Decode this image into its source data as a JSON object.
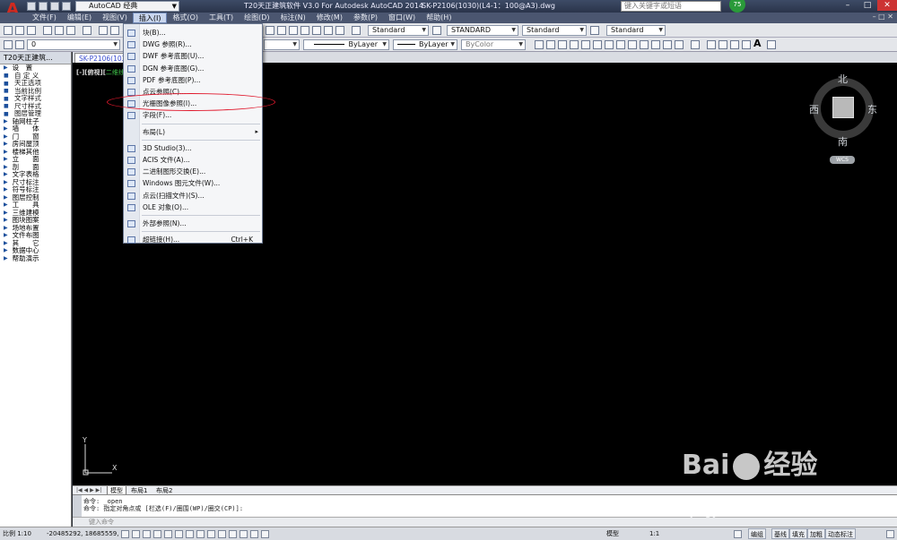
{
  "app": {
    "title": "T20天正建筑软件 V3.0 For Autodesk AutoCAD 2014",
    "file": "SK-P2106(1030)(L4-1：100@A3).dwg",
    "workspace": "AutoCAD 经典",
    "search_placeholder": "键入关键字或短语",
    "badge": "75"
  },
  "menubar": {
    "items": [
      "文件(F)",
      "编辑(E)",
      "视图(V)",
      "插入(I)",
      "格式(O)",
      "工具(T)",
      "绘图(D)",
      "标注(N)",
      "修改(M)",
      "参数(P)",
      "窗口(W)",
      "帮助(H)"
    ],
    "active_index": 3
  },
  "toolbar1": {
    "text_style": "Standard",
    "dim_style": "STANDARD",
    "table_style": "Standard",
    "mleader_style": "Standard"
  },
  "toolbar2": {
    "layer": "0",
    "linetype": "ByLayer",
    "lineweight": "ByLayer",
    "color": "ByColor"
  },
  "left_panel": {
    "header": "T20天正建筑...",
    "items": [
      {
        "label": "设　置",
        "kind": "section"
      },
      {
        "label": "自 定 义",
        "kind": "item"
      },
      {
        "label": "天正选项",
        "kind": "item"
      },
      {
        "label": "当前比例",
        "kind": "item"
      },
      {
        "label": "文字样式",
        "kind": "item"
      },
      {
        "label": "尺寸样式",
        "kind": "item"
      },
      {
        "label": "图层管理",
        "kind": "item"
      },
      {
        "label": "轴网柱子",
        "kind": "section"
      },
      {
        "label": "墙　　体",
        "kind": "section"
      },
      {
        "label": "门　　窗",
        "kind": "section"
      },
      {
        "label": "房间屋顶",
        "kind": "section"
      },
      {
        "label": "楼梯其他",
        "kind": "section"
      },
      {
        "label": "立　　面",
        "kind": "section"
      },
      {
        "label": "剖　　面",
        "kind": "section"
      },
      {
        "label": "文字表格",
        "kind": "section"
      },
      {
        "label": "尺寸标注",
        "kind": "section"
      },
      {
        "label": "符号标注",
        "kind": "section"
      },
      {
        "label": "图层控制",
        "kind": "section"
      },
      {
        "label": "工　　具",
        "kind": "section"
      },
      {
        "label": "三维建模",
        "kind": "section"
      },
      {
        "label": "图块图案",
        "kind": "section"
      },
      {
        "label": "场地布置",
        "kind": "section"
      },
      {
        "label": "文件布图",
        "kind": "section"
      },
      {
        "label": "其　　它",
        "kind": "section"
      },
      {
        "label": "数据中心",
        "kind": "section"
      },
      {
        "label": "帮助演示",
        "kind": "section"
      }
    ]
  },
  "drawing": {
    "doc_tab": "SK-P2106(1030)",
    "view_label_prefix": "[-][俯视][",
    "view_label_mode": "二维线框",
    "view_label_suffix": "]",
    "compass": {
      "north": "北",
      "south": "南",
      "east": "东",
      "west": "西",
      "cube_top": "上"
    },
    "wcs": "WCS",
    "ucs_x": "X",
    "ucs_y": "Y"
  },
  "layout_tabs": [
    "模型",
    "布局1",
    "布局2"
  ],
  "insert_menu": {
    "items": [
      {
        "label": "块(B)...",
        "icon": "block-icon",
        "group": 0
      },
      {
        "label": "DWG 参照(R)...",
        "icon": "dwg-ref-icon",
        "group": 0
      },
      {
        "label": "DWF 参考底图(U)...",
        "icon": "dwf-icon",
        "group": 0
      },
      {
        "label": "DGN 参考底图(G)...",
        "icon": "dgn-icon",
        "group": 0
      },
      {
        "label": "PDF 参考底图(P)...",
        "icon": "pdf-icon",
        "group": 0
      },
      {
        "label": "点云参照(C)...",
        "icon": "point-cloud-icon",
        "group": 0
      },
      {
        "label": "光栅图像参照(I)...",
        "icon": "raster-image-icon",
        "group": 0
      },
      {
        "label": "字段(F)...",
        "icon": "field-icon",
        "group": 0
      },
      {
        "label": "布局(L)",
        "icon": "",
        "group": 1,
        "submenu": true
      },
      {
        "label": "3D Studio(3)...",
        "icon": "3ds-icon",
        "group": 2
      },
      {
        "label": "ACIS 文件(A)...",
        "icon": "acis-icon",
        "group": 2
      },
      {
        "label": "二进制图形交换(E)...",
        "icon": "dxb-icon",
        "group": 2
      },
      {
        "label": "Windows 图元文件(W)...",
        "icon": "wmf-icon",
        "group": 2
      },
      {
        "label": "点云(扫描文件)(S)...",
        "icon": "scan-icon",
        "group": 2
      },
      {
        "label": "OLE 对象(O)...",
        "icon": "ole-icon",
        "group": 2
      },
      {
        "label": "外部参照(N)...",
        "icon": "xref-icon",
        "group": 3
      },
      {
        "label": "超链接(H)...",
        "icon": "hyperlink-icon",
        "group": 4,
        "shortcut": "Ctrl+K"
      }
    ],
    "highlighted_index": 6
  },
  "command": {
    "line1": "命令: _open",
    "line2": "命令: 指定对角点或 [栏选(F)/圈围(WP)/圈交(CP)]:",
    "placeholder": "键入命令"
  },
  "statusbar": {
    "scale": "比例 1:10",
    "coords": "-20485292, 18685559, 0",
    "model": "模型",
    "annotation_scale": "1:1",
    "buttons": [
      "编组",
      "基线",
      "填充",
      "加粗",
      "动态标注"
    ]
  },
  "watermark": {
    "brand_left": "Bai",
    "brand_right": "经验",
    "url": "jingyan.baidu.com"
  }
}
